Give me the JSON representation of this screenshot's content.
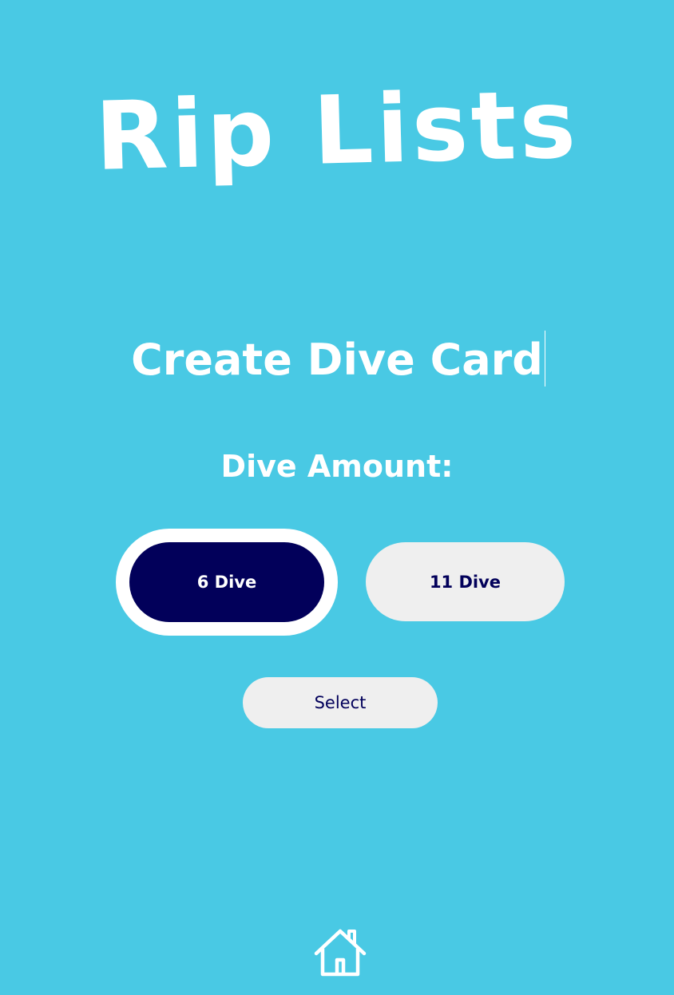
{
  "header": {
    "logo_text": "Rip Lists"
  },
  "main": {
    "title": "Create Dive Card",
    "dive_amount_label": "Dive Amount:",
    "options": [
      {
        "label": "6 Dive",
        "selected": true
      },
      {
        "label": "11 Dive",
        "selected": false
      }
    ],
    "select_label": "Select"
  },
  "footer": {
    "home_icon": "home-icon"
  },
  "colors": {
    "background": "#49c9e4",
    "selected_fill": "#02005a",
    "button_fill": "#efefef",
    "text_dark": "#02005a",
    "text_light": "#ffffff"
  }
}
